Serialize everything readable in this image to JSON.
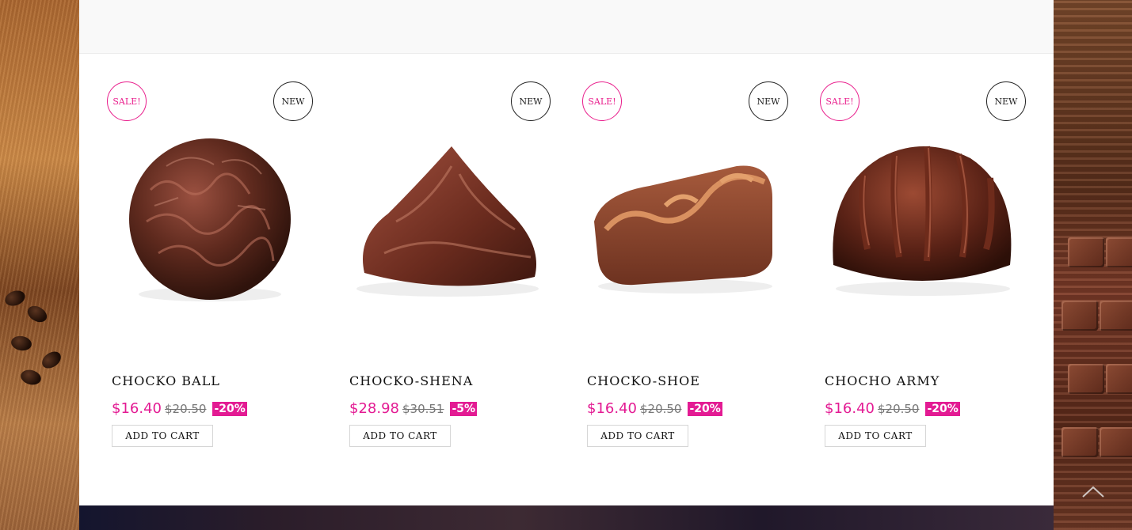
{
  "products": [
    {
      "sale_badge": "SALE!",
      "new_badge": "NEW",
      "name": "CHOCKO BALL",
      "price": "$16.40",
      "old_price": "$20.50",
      "discount": "-20%",
      "button": "ADD TO CART",
      "has_sale": true
    },
    {
      "sale_badge": "",
      "new_badge": "NEW",
      "name": "CHOCKO-SHENA",
      "price": "$28.98",
      "old_price": "$30.51",
      "discount": "-5%",
      "button": "ADD TO CART",
      "has_sale": false
    },
    {
      "sale_badge": "SALE!",
      "new_badge": "NEW",
      "name": "CHOCKO-SHOE",
      "price": "$16.40",
      "old_price": "$20.50",
      "discount": "-20%",
      "button": "ADD TO CART",
      "has_sale": true
    },
    {
      "sale_badge": "SALE!",
      "new_badge": "NEW",
      "name": "CHOCHO ARMY",
      "price": "$16.40",
      "old_price": "$20.50",
      "discount": "-20%",
      "button": "ADD TO CART",
      "has_sale": true
    }
  ],
  "colors": {
    "accent": "#e31b93",
    "sale_border": "#e91e8c",
    "text": "#111111",
    "old_price": "#777777"
  },
  "icons": {
    "scroll_top": "chevron-up-icon"
  }
}
